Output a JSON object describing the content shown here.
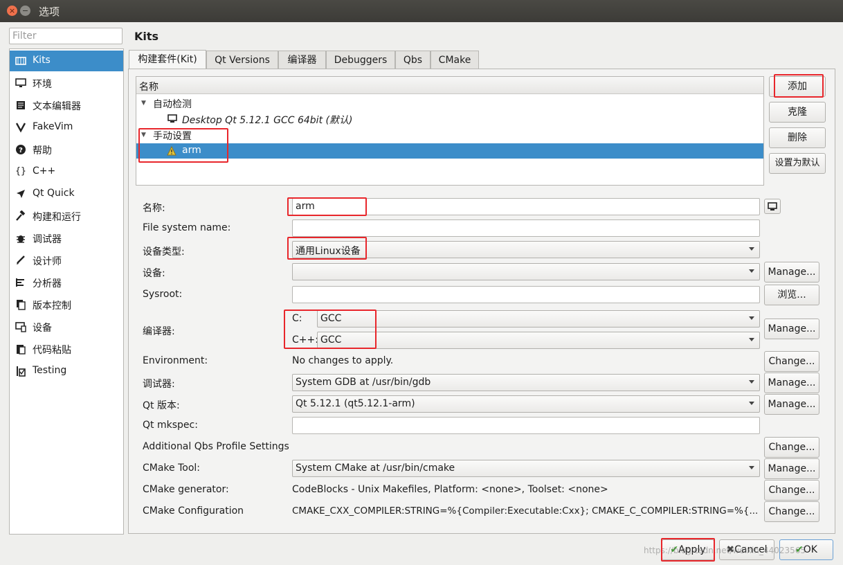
{
  "window": {
    "title": "选项",
    "close_glyph": "×",
    "min_glyph": "−"
  },
  "sidebar": {
    "filter_placeholder": "Filter",
    "items": [
      {
        "label": "Kits",
        "icon": "kits-icon"
      },
      {
        "label": "环境",
        "icon": "monitor-icon"
      },
      {
        "label": "文本编辑器",
        "icon": "text-editor-icon"
      },
      {
        "label": "FakeVim",
        "icon": "fakevim-icon"
      },
      {
        "label": "帮助",
        "icon": "help-icon"
      },
      {
        "label": "C++",
        "icon": "braces-icon"
      },
      {
        "label": "Qt Quick",
        "icon": "qtquick-icon"
      },
      {
        "label": "构建和运行",
        "icon": "hammer-icon"
      },
      {
        "label": "调试器",
        "icon": "bug-icon"
      },
      {
        "label": "设计师",
        "icon": "pen-icon"
      },
      {
        "label": "分析器",
        "icon": "analyzer-icon"
      },
      {
        "label": "版本控制",
        "icon": "version-control-icon"
      },
      {
        "label": "设备",
        "icon": "device-icon"
      },
      {
        "label": "代码粘贴",
        "icon": "paste-icon"
      },
      {
        "label": "Testing",
        "icon": "testing-icon"
      }
    ]
  },
  "page_title": "Kits",
  "tabs": [
    {
      "label": "构建套件(Kit)"
    },
    {
      "label": "Qt Versions"
    },
    {
      "label": "编译器"
    },
    {
      "label": "Debuggers"
    },
    {
      "label": "Qbs"
    },
    {
      "label": "CMake"
    }
  ],
  "tree": {
    "header": "名称",
    "auto_group": "自动检测",
    "auto_kit": "Desktop Qt 5.12.1 GCC 64bit (默认)",
    "manual_group": "手动设置",
    "manual_kit": "arm"
  },
  "side_buttons": {
    "add": "添加",
    "clone": "克隆",
    "remove": "删除",
    "make_default": "设置为默认"
  },
  "form": {
    "name_label": "名称:",
    "name_value": "arm",
    "fs_label": "File system name:",
    "fs_value": "",
    "device_type_label": "设备类型:",
    "device_type_value": "通用Linux设备",
    "device_label": "设备:",
    "device_value": "",
    "sysroot_label": "Sysroot:",
    "sysroot_value": "",
    "browse": "浏览...",
    "compiler_label": "编译器:",
    "c_label": "C:",
    "c_value": "GCC",
    "cxx_label": "C++:",
    "cxx_value": "GCC",
    "env_label": "Environment:",
    "env_value": "No changes to apply.",
    "debugger_label": "调试器:",
    "debugger_value": "System GDB at /usr/bin/gdb",
    "qt_label": "Qt 版本:",
    "qt_value": "Qt 5.12.1 (qt5.12.1-arm)",
    "mkspec_label": "Qt mkspec:",
    "mkspec_value": "",
    "qbs_label": "Additional Qbs Profile Settings",
    "cmake_tool_label": "CMake Tool:",
    "cmake_tool_value": "System CMake at /usr/bin/cmake",
    "cmake_gen_label": "CMake generator:",
    "cmake_gen_value": "CodeBlocks - Unix Makefiles, Platform: <none>, Toolset: <none>",
    "cmake_conf_label": "CMake Configuration",
    "cmake_conf_value": "CMAKE_CXX_COMPILER:STRING=%{Compiler:Executable:Cxx}; CMAKE_C_COMPILER:STRING=%{...",
    "manage": "Manage...",
    "change": "Change..."
  },
  "footer": {
    "apply": "Apply",
    "cancel": "Cancel",
    "ok": "OK"
  },
  "watermark": "https://blog.csdn.net/weixin_44023565",
  "colors": {
    "selection": "#3c8dc9",
    "highlight_box": "#e8262b"
  }
}
